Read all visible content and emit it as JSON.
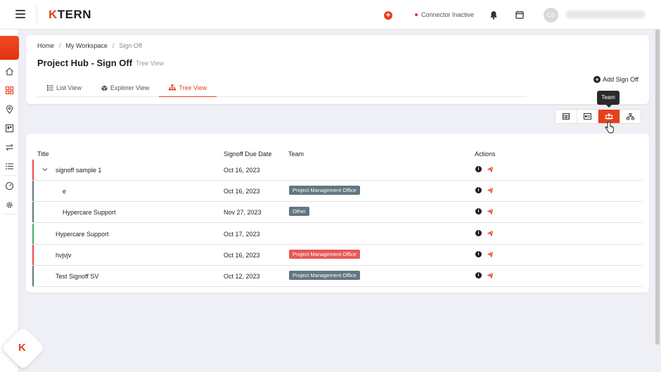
{
  "app": {
    "logo_text": "TERN",
    "logo_k": "K",
    "connector_status": "Connector Inactive",
    "user_initials": "CS",
    "brand_color": "#e8401c"
  },
  "breadcrumb": [
    "Home",
    "My Workspace",
    "Sign Off"
  ],
  "page": {
    "title": "Project Hub - Sign Off",
    "subtitle": "Tree View"
  },
  "tabs": [
    {
      "label": "List View",
      "icon": "list-icon"
    },
    {
      "label": "Explorer View",
      "icon": "cube-icon"
    },
    {
      "label": "Tree View",
      "icon": "tree-icon",
      "active": true
    }
  ],
  "actions": {
    "add_signoff": "Add Sign Off",
    "tooltip": "Team"
  },
  "table": {
    "columns": [
      "Title",
      "Signoff Due Date",
      "Team",
      "Actions"
    ],
    "rows": [
      {
        "title": "signoff sample 1",
        "date": "Oct 16, 2023",
        "team": "",
        "team_color": "",
        "bar_color": "#e84a4a",
        "expandable": true
      },
      {
        "title": "e",
        "date": "Oct 16, 2023",
        "team": "Project Management Office",
        "team_color": "#627780",
        "bar_color": "#627780"
      },
      {
        "title": "Hypercare Support",
        "date": "Nov 27, 2023",
        "team": "Other",
        "team_color": "#627780",
        "bar_color": "#627780"
      },
      {
        "title": "Hypercare Support",
        "date": "Oct 17, 2023",
        "team": "",
        "team_color": "",
        "bar_color": "#3fb36b"
      },
      {
        "title": "hvjvjv",
        "date": "Oct 16, 2023",
        "team": "Project Management Office",
        "team_color": "#e8585a",
        "bar_color": "#e84a4a"
      },
      {
        "title": "Test Signoff SV",
        "date": "Oct 12, 2023",
        "team": "Project Management Office",
        "team_color": "#627780",
        "bar_color": "#627780"
      }
    ]
  }
}
